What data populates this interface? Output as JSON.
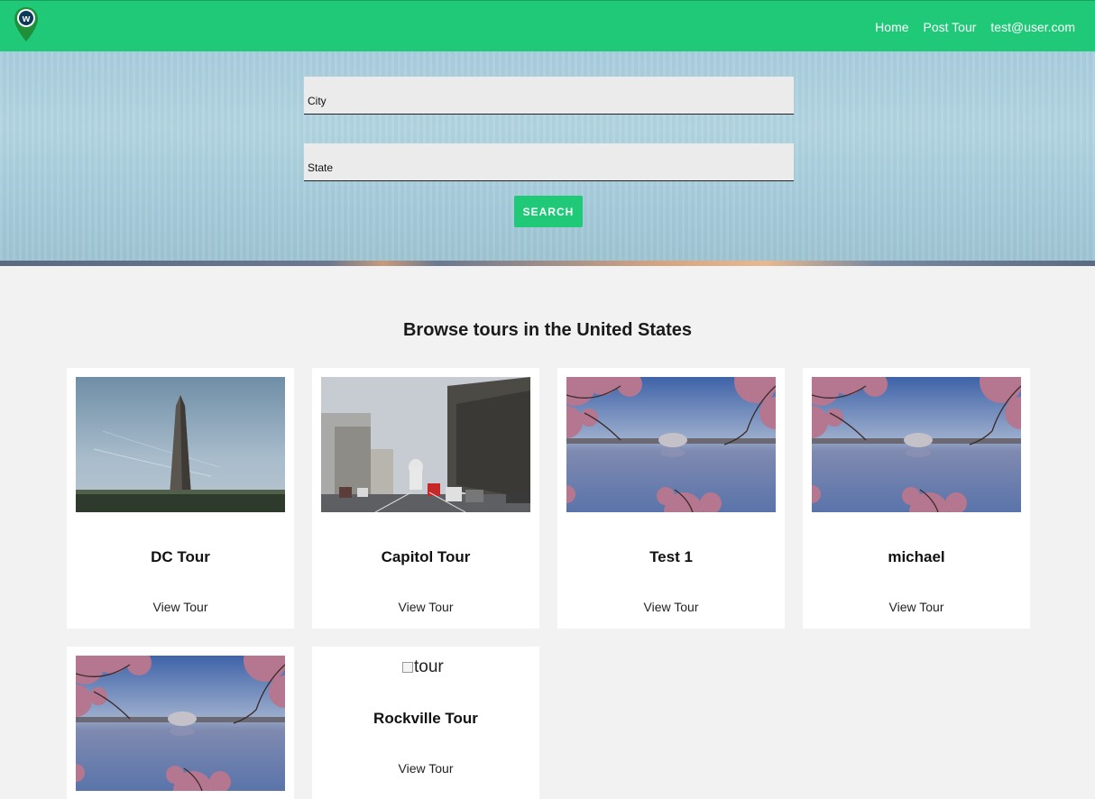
{
  "nav": {
    "logo_letter": "w",
    "links": [
      "Home",
      "Post Tour",
      "test@user.com"
    ]
  },
  "search": {
    "city_placeholder": "City",
    "state_placeholder": "State",
    "button_label": "SEARCH"
  },
  "section_title": "Browse tours in the United States",
  "tours": [
    {
      "name": "DC Tour",
      "link": "View Tour"
    },
    {
      "name": "Capitol Tour",
      "link": "View Tour"
    },
    {
      "name": "Test 1",
      "link": "View Tour"
    },
    {
      "name": "michael",
      "link": "View Tour"
    },
    {
      "name": "",
      "link": ""
    },
    {
      "name": "Rockville Tour",
      "link": "View Tour",
      "image_alt": "tour"
    }
  ],
  "colors": {
    "brand_green": "#20c978"
  }
}
